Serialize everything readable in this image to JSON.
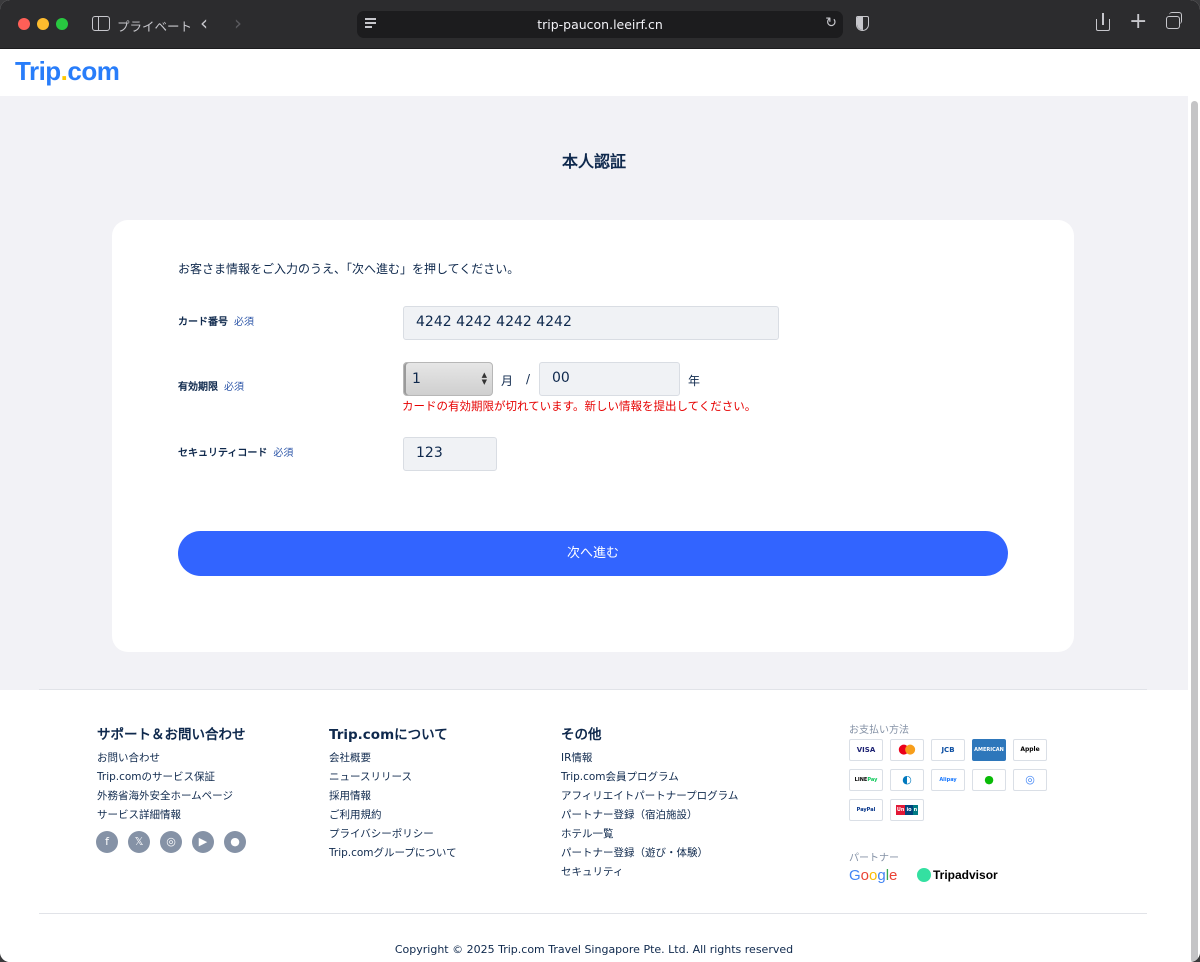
{
  "browser": {
    "private_label": "プライベート",
    "back": "‹",
    "forward": "›",
    "url": "trip-paucon.leeirf.cn",
    "reload": "↻",
    "new_tab": "+"
  },
  "site": {
    "logo_main": "Trip",
    "logo_dot": ".",
    "logo_tail": "com",
    "brand_color": "#287dfa"
  },
  "page": {
    "title": "本人認証",
    "instruction": "お客さま情報をご入力のうえ、「次へ進む」を押してください。",
    "required_label": "必須",
    "card_number": {
      "label": "カード番号",
      "value": "4242 4242 4242 4242"
    },
    "expiry": {
      "label": "有効期限",
      "month_value": "1",
      "month_unit": "月",
      "separator": "/",
      "year_value": "00",
      "year_unit": "年",
      "error": "カードの有効期限が切れています。新しい情報を提出してください。"
    },
    "cvc": {
      "label": "セキュリティコード",
      "value": "123"
    },
    "submit_label": "次へ進む",
    "button_color": "#3264ff",
    "error_color": "#e60000"
  },
  "footer": {
    "support": {
      "heading": "サポート＆お問い合わせ",
      "links": [
        "お問い合わせ",
        "Trip.comのサービス保証",
        "外務省海外安全ホームページ",
        "サービス詳細情報"
      ]
    },
    "about": {
      "heading": "Trip.comについて",
      "links": [
        "会社概要",
        "ニュースリリース",
        "採用情報",
        "ご利用規約",
        "プライバシーポリシー",
        "Trip.comグループについて"
      ]
    },
    "other": {
      "heading": "その他",
      "links": [
        "IR情報",
        "Trip.com会員プログラム",
        "アフィリエイトパートナープログラム",
        "パートナー登録（宿泊施設）",
        "ホテル一覧",
        "パートナー登録（遊び・体験）",
        "セキュリティ"
      ]
    },
    "social_icons": [
      "facebook-icon",
      "x-icon",
      "instagram-icon",
      "youtube-icon",
      "line-icon"
    ],
    "payment": {
      "title": "お支払い方法",
      "methods": [
        "VISA",
        "Mastercard",
        "JCB",
        "AMEX",
        "Apple Pay",
        "LINE Pay",
        "Diners",
        "Alipay",
        "WeChat Pay",
        "PayPay",
        "PayPal",
        "UnionPay"
      ]
    },
    "partners": {
      "title": "パートナー",
      "google": "Google",
      "tripadvisor": "Tripadvisor"
    },
    "copyright": "Copyright © 2025 Trip.com Travel Singapore Pte. Ltd. All rights reserved"
  }
}
